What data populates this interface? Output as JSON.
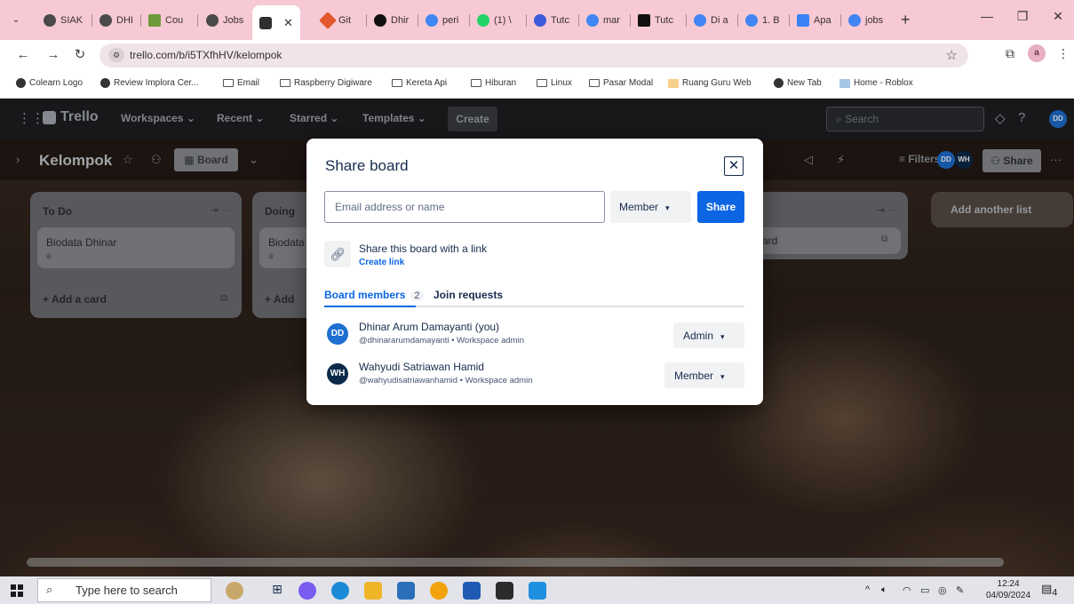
{
  "browser": {
    "tabs": [
      {
        "label": "SIAK",
        "color": "#4a4a4a"
      },
      {
        "label": "DHI",
        "color": "#4a4a4a"
      },
      {
        "label": "Cou",
        "color": "#6e9a3a"
      },
      {
        "label": "Jobs",
        "color": "#4a4a4a"
      },
      {
        "label": "",
        "color": "#2f2f2f"
      },
      {
        "label": "Git",
        "color": "#e2572b"
      },
      {
        "label": "Dhir",
        "color": "#111111"
      },
      {
        "label": "peri",
        "color": "#4285f4"
      },
      {
        "label": "(1) \\",
        "color": "#25d366"
      },
      {
        "label": "Tutc",
        "color": "#3b5bdb"
      },
      {
        "label": "mar",
        "color": "#4285f4"
      },
      {
        "label": "Tutc",
        "color": "#111111"
      },
      {
        "label": "Di a",
        "color": "#4285f4"
      },
      {
        "label": "1. B",
        "color": "#4285f4"
      },
      {
        "label": "Apa",
        "color": "#3b82f6"
      },
      {
        "label": "jobs",
        "color": "#4285f4"
      }
    ],
    "url": "trello.com/b/i5TXfhHV/kelompok",
    "profile_initial": "a",
    "bookmarks": [
      {
        "label": "Colearn Logo",
        "type": "globe"
      },
      {
        "label": "Review Implora Cer...",
        "type": "globe"
      },
      {
        "label": "Email",
        "type": "folder"
      },
      {
        "label": "Raspberry Digiware",
        "type": "folder"
      },
      {
        "label": "Kereta Api",
        "type": "folder"
      },
      {
        "label": "Hiburan",
        "type": "folder"
      },
      {
        "label": "Linux",
        "type": "folder"
      },
      {
        "label": "Pasar Modal",
        "type": "folder"
      },
      {
        "label": "Ruang Guru Web",
        "type": "site"
      },
      {
        "label": "New Tab",
        "type": "globe"
      },
      {
        "label": "Home - Roblox",
        "type": "site"
      }
    ]
  },
  "trello": {
    "header": {
      "logo": "Trello",
      "nav": [
        "Workspaces",
        "Recent",
        "Starred",
        "Templates"
      ],
      "create": "Create",
      "search_placeholder": "Search",
      "avatar": "DD"
    },
    "board": {
      "title": "Kelompok",
      "view": "Board",
      "filters": "Filters",
      "share": "Share",
      "member_avatars": [
        "DD",
        "WH"
      ]
    },
    "lists": [
      {
        "title": "To Do",
        "card": "Biodata Dhinar",
        "add": "+ Add a card"
      },
      {
        "title": "Doing",
        "card": "Biodata",
        "add": "+ Add"
      },
      {
        "title": "",
        "card": "ard",
        "add": ""
      }
    ],
    "add_list": "Add another list"
  },
  "modal": {
    "title": "Share board",
    "email_placeholder": "Email address or name",
    "role": "Member",
    "share_button": "Share",
    "link_text": "Share this board with a link",
    "create_link": "Create link",
    "tab_members": "Board members",
    "tab_members_count": "2",
    "tab_requests": "Join requests",
    "members": [
      {
        "initials": "DD",
        "name": "Dhinar Arum Damayanti (you)",
        "sub": "@dhinararumdamayanti • Workspace admin",
        "role": "Admin",
        "color": "#1d6fd1"
      },
      {
        "initials": "WH",
        "name": "Wahyudi Satriawan Hamid",
        "sub": "@wahyudisatriawanhamid • Workspace admin",
        "role": "Member",
        "color": "#0b2a4a"
      }
    ]
  },
  "taskbar": {
    "search_placeholder": "Type here to search",
    "time": "12:24",
    "date": "04/09/2024",
    "notifications": "4"
  }
}
